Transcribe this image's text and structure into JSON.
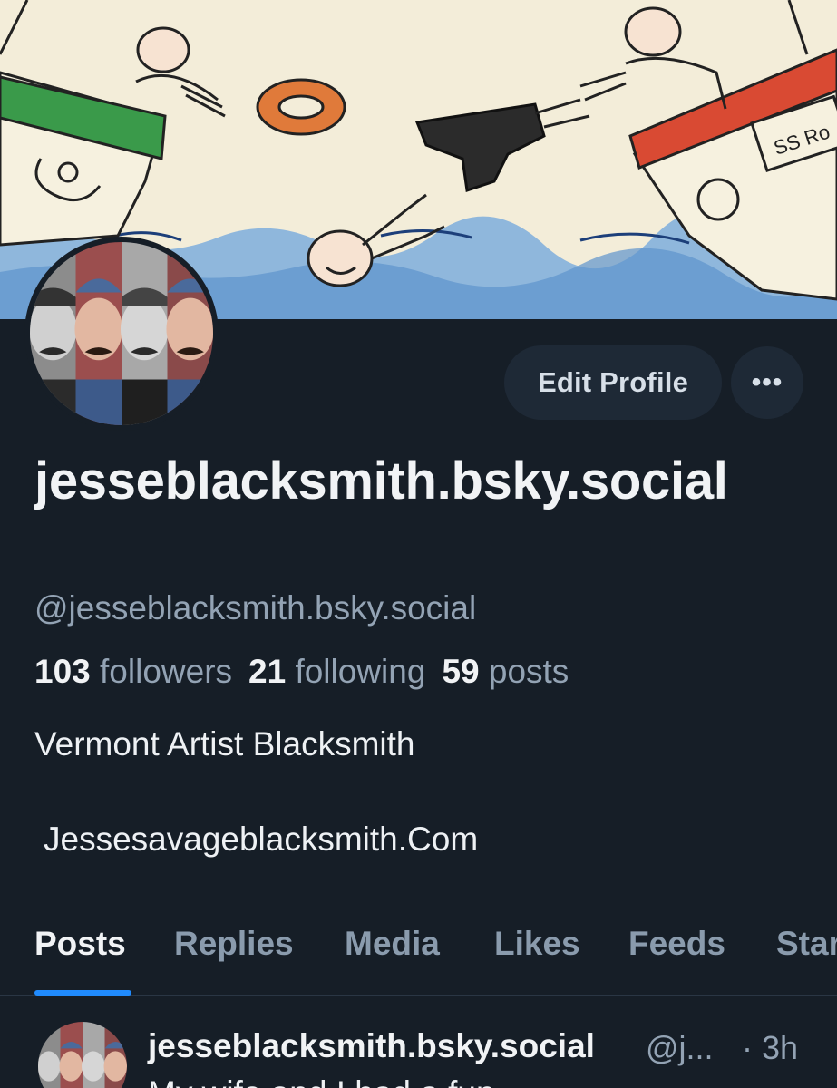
{
  "profile": {
    "display_name": "jesseblacksmith.bsky.social",
    "handle": "@jesseblacksmith.bsky.social",
    "followers_count": "103",
    "followers_label": "followers",
    "following_count": "21",
    "following_label": "following",
    "posts_count": "59",
    "posts_label": "posts",
    "bio_line": "Vermont Artist Blacksmith",
    "website": "Jessesavageblacksmith.Com"
  },
  "actions": {
    "edit_profile_label": "Edit Profile",
    "more_label": "•••"
  },
  "tabs": [
    {
      "label": "Posts",
      "active": true
    },
    {
      "label": "Replies",
      "active": false
    },
    {
      "label": "Media",
      "active": false
    },
    {
      "label": "Likes",
      "active": false
    },
    {
      "label": "Feeds",
      "active": false
    },
    {
      "label": "Starter Packs",
      "active": false
    }
  ],
  "post": {
    "author": "jesseblacksmith.bsky.social",
    "handle": "@j...",
    "time": "· 3h",
    "text": "My wife and I had a fun..."
  },
  "banner": {
    "ship_label": "SS Ro"
  },
  "colors": {
    "background": "#161e27",
    "button_bg": "#1e2936",
    "accent": "#208bfe",
    "muted_text": "#93a3b4"
  }
}
